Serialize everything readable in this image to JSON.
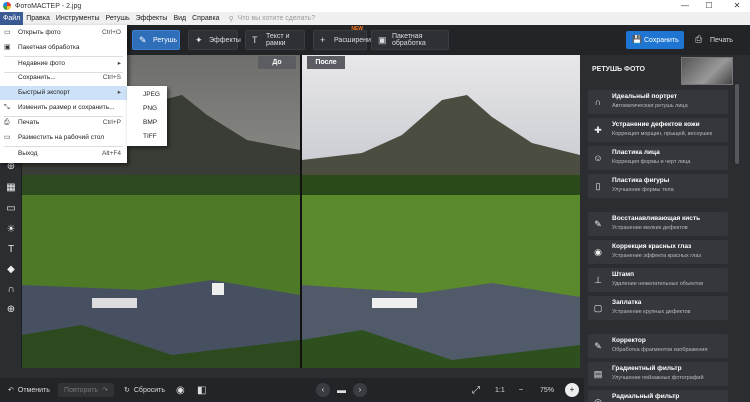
{
  "window": {
    "title": "ФотоМАСТЕР - 2.jpg",
    "minimize": "—",
    "maximize": "☐",
    "close": "✕"
  },
  "menubar": {
    "items": [
      "Файл",
      "Правка",
      "Инструменты",
      "Ретушь",
      "Эффекты",
      "Вид",
      "Справка"
    ],
    "search_placeholder": "Что вы хотите сделать?"
  },
  "toolbar": {
    "tabs": [
      {
        "label": "Ретушь",
        "icon": "brush-icon"
      },
      {
        "label": "Эффекты",
        "icon": "wand-icon"
      },
      {
        "label": "Текст и рамки",
        "icon": "text-icon"
      },
      {
        "label": "Расширения",
        "icon": "plus-icon",
        "badge": "NEW"
      },
      {
        "label": "Пакетная обработка",
        "icon": "images-icon"
      }
    ],
    "save_label": "Сохранить",
    "print_label": "Печать"
  },
  "file_menu": {
    "items": [
      {
        "label": "Открыть фото",
        "shortcut": "Ctrl+O",
        "icon": "folder-icon"
      },
      {
        "label": "Пакетная обработка",
        "shortcut": "",
        "icon": "images-icon"
      },
      {
        "label": "Недавние фото",
        "shortcut": "▸",
        "icon": ""
      },
      {
        "label": "Сохранить...",
        "shortcut": "Ctrl+S",
        "icon": ""
      },
      {
        "label": "Быстрый экспорт",
        "shortcut": "▸",
        "icon": ""
      },
      {
        "label": "Изменить размер и сохранить...",
        "shortcut": "",
        "icon": "resize-icon"
      },
      {
        "label": "Печать",
        "shortcut": "Ctrl+P",
        "icon": "printer-icon"
      },
      {
        "label": "Разместить на рабочий стол",
        "shortcut": "",
        "icon": "monitor-icon"
      },
      {
        "label": "Выход",
        "shortcut": "Alt+F4",
        "icon": ""
      }
    ],
    "quick_export": [
      "JPEG",
      "PNG",
      "BMP",
      "TIFF"
    ]
  },
  "canvas": {
    "before_label": "До",
    "after_label": "После"
  },
  "panel": {
    "title": "РЕТУШЬ ФОТО",
    "items": [
      {
        "title": "Идеальный портрет",
        "subtitle": "Автоматическая ретушь лица",
        "icon": "face-profile-icon"
      },
      {
        "title": "Устранение дефектов кожи",
        "subtitle": "Коррекция морщин, прыщей, веснушек",
        "icon": "skin-icon"
      },
      {
        "title": "Пластика лица",
        "subtitle": "Коррекция формы и черт лица",
        "icon": "face-icon"
      },
      {
        "title": "Пластика фигуры",
        "subtitle": "Улучшение формы тела",
        "icon": "body-icon"
      },
      {
        "title": "Восстанавливающая кисть",
        "subtitle": "Устранение мелких дефектов",
        "icon": "healing-brush-icon"
      },
      {
        "title": "Коррекция красных глаз",
        "subtitle": "Устранение эффекта красных глаз",
        "icon": "eye-icon"
      },
      {
        "title": "Штамп",
        "subtitle": "Удаление нежелательных объектов",
        "icon": "stamp-icon"
      },
      {
        "title": "Заплатка",
        "subtitle": "Устранение крупных дефектов",
        "icon": "patch-icon"
      },
      {
        "title": "Корректор",
        "subtitle": "Обработка фрагментов изображения",
        "icon": "corrector-icon"
      },
      {
        "title": "Градиентный фильтр",
        "subtitle": "Улучшение пейзажных фотографий",
        "icon": "gradient-icon"
      },
      {
        "title": "Радиальный фильтр",
        "subtitle": "",
        "icon": "radial-icon"
      }
    ]
  },
  "bottombar": {
    "undo_label": "Отменить",
    "redo_label": "Повторить",
    "reset_label": "Сбросить",
    "ratio_label": "1:1",
    "zoom": "75%"
  }
}
